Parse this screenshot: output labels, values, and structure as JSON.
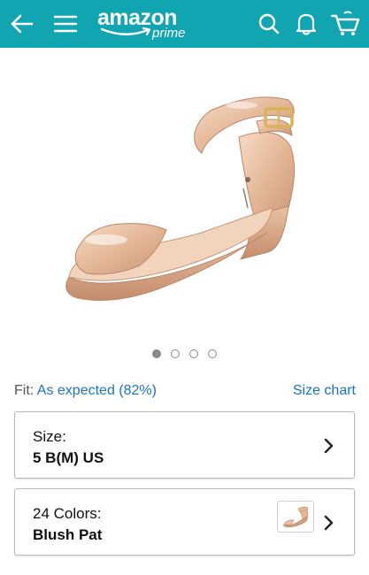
{
  "header": {
    "logo_main": "amazon",
    "logo_sub": "prime",
    "background_color": "#11a4b1",
    "icons": [
      "back-arrow-icon",
      "menu-icon",
      "search-icon",
      "bell-icon",
      "cart-icon"
    ]
  },
  "gallery": {
    "image_count": 4,
    "active_index": 0
  },
  "fit": {
    "label": "Fit:",
    "value": "As expected (82%)",
    "size_chart_label": "Size chart"
  },
  "size_selector": {
    "label": "Size:",
    "value": "5 B(M) US"
  },
  "color_selector": {
    "label": "24 Colors:",
    "value": "Blush Pat"
  },
  "colors": {
    "link": "#1a73c8"
  }
}
